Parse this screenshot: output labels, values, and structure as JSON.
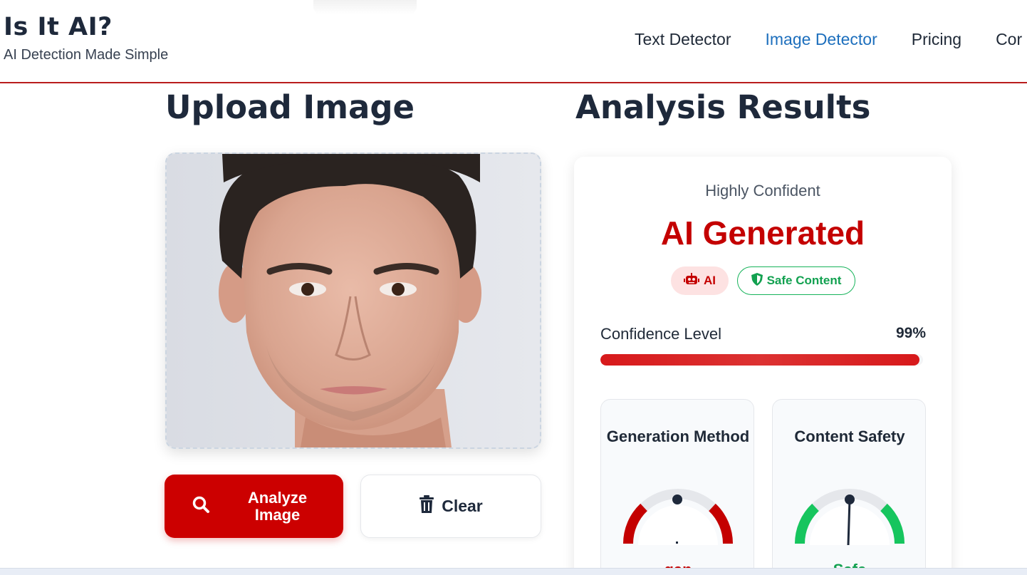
{
  "header": {
    "logo_title": "Is It AI?",
    "logo_subtitle": "AI Detection Made Simple",
    "nav": [
      {
        "label": "Text Detector",
        "active": false
      },
      {
        "label": "Image Detector",
        "active": true
      },
      {
        "label": "Pricing",
        "active": false
      },
      {
        "label": "Cor",
        "active": false
      }
    ],
    "accent_color": "#b91c1c",
    "active_nav_color": "#1d6fbd"
  },
  "upload": {
    "heading": "Upload Image",
    "analyze_label": "Analyze Image",
    "clear_label": "Clear",
    "analyze_icon": "search-icon",
    "clear_icon": "trash-icon"
  },
  "results": {
    "heading": "Analysis Results",
    "confidence_word": "Highly Confident",
    "verdict": "AI Generated",
    "verdict_color": "#c40000",
    "badges": [
      {
        "label": "AI",
        "icon": "robot-icon"
      },
      {
        "label": "Safe Content",
        "icon": "shield-icon"
      }
    ],
    "confidence_label": "Confidence Level",
    "confidence_value": "99%",
    "confidence_fraction": 0.99,
    "metrics": [
      {
        "title": "Generation Method",
        "value": "gan",
        "value_color": "#c40000",
        "gauge_color": "#c40000"
      },
      {
        "title": "Content Safety",
        "value": "Safe",
        "value_color": "#12a150",
        "gauge_color": "#16c55e"
      }
    ]
  }
}
